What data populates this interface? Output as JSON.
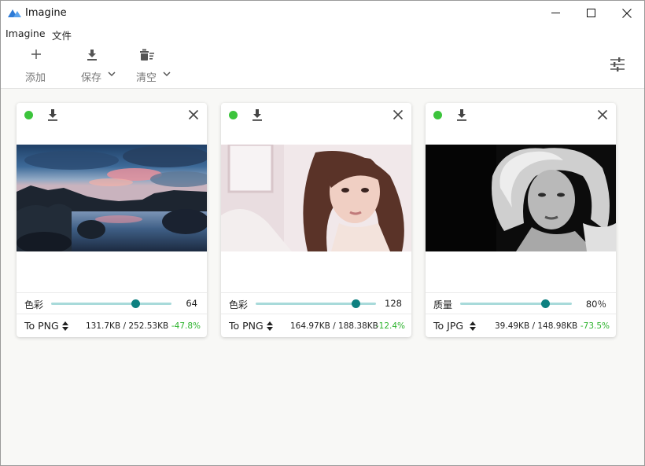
{
  "window": {
    "title": "Imagine"
  },
  "menu": [
    {
      "label": "Imagine"
    },
    {
      "label": "文件"
    }
  ],
  "toolbar": {
    "add_label": "添加",
    "save_label": "保存",
    "clear_label": "清空"
  },
  "colors": {
    "status_ok": "#3cc43c",
    "slider_track": "#a8dada",
    "slider_thumb": "#0d8080",
    "reduction": "#2db32d"
  },
  "cards": [
    {
      "status": "ready",
      "image": "rocky lake at sunset",
      "option_label": "色彩",
      "option_value": "64",
      "slider_level": 0.7,
      "format": "To PNG",
      "sizes": "131.7KB / 252.53KB",
      "ratio": "-47.8%"
    },
    {
      "status": "ready",
      "image": "portrait of young woman",
      "option_label": "色彩",
      "option_value": "128",
      "slider_level": 0.83,
      "format": "To PNG",
      "sizes": "164.97KB / 188.38KB",
      "ratio": "-12.4%"
    },
    {
      "status": "ready",
      "image": "black and white portrait of blonde woman",
      "option_label": "质量",
      "option_value": "80％",
      "slider_level": 0.76,
      "format": "To JPG",
      "sizes": "39.49KB / 148.98KB",
      "ratio": "-73.5%"
    }
  ]
}
